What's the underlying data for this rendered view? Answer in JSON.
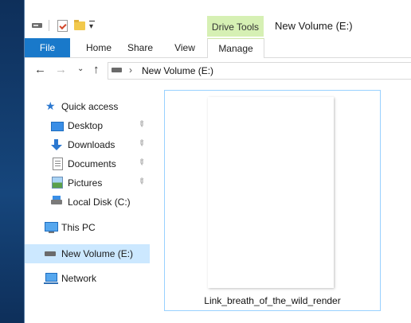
{
  "title_bar": {
    "window_title": "New Volume (E:)",
    "context_tab_group": "Drive Tools",
    "qat_icons": [
      "drive-icon",
      "properties-icon",
      "new-folder-icon",
      "customize-qat-icon"
    ]
  },
  "ribbon": {
    "tabs": [
      {
        "label": "File"
      },
      {
        "label": "Home"
      },
      {
        "label": "Share"
      },
      {
        "label": "View"
      },
      {
        "label": "Manage"
      }
    ],
    "file_tab_color": "#1979ca",
    "context_color": "#d6f0b4"
  },
  "address": {
    "back_icon": "back-arrow-icon",
    "forward_icon": "forward-arrow-icon",
    "recent_icon": "chevron-down-icon",
    "up_icon": "up-arrow-icon",
    "separator": "›",
    "location": "New Volume (E:)"
  },
  "nav_pane": {
    "quick_access": "Quick access",
    "items": [
      {
        "label": "Desktop",
        "icon": "desktop-icon",
        "pinned": true
      },
      {
        "label": "Downloads",
        "icon": "downloads-icon",
        "pinned": true
      },
      {
        "label": "Documents",
        "icon": "documents-icon",
        "pinned": true
      },
      {
        "label": "Pictures",
        "icon": "pictures-icon",
        "pinned": true
      },
      {
        "label": "Local Disk (C:)",
        "icon": "local-disk-icon",
        "pinned": false
      }
    ],
    "this_pc": "This PC",
    "selected": "New Volume (E:)",
    "network": "Network",
    "selection_color": "#cce8ff"
  },
  "content": {
    "files": [
      {
        "name": "Link_breath_of_the_wild_render",
        "selected": true
      }
    ],
    "selection_border_color": "#99d1ff"
  }
}
